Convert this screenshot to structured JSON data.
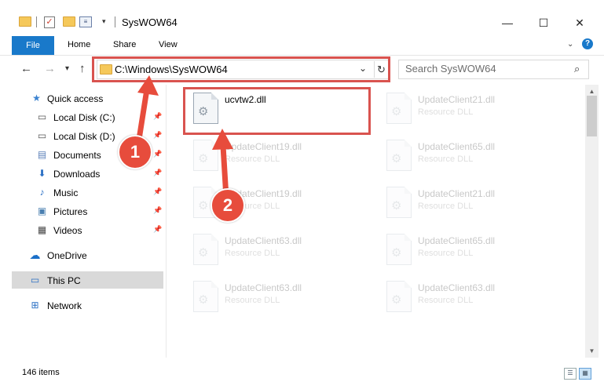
{
  "window": {
    "title": "SysWOW64"
  },
  "ribbon": {
    "tabs": [
      "File",
      "Home",
      "Share",
      "View"
    ]
  },
  "address": {
    "path": "C:\\Windows\\SysWOW64"
  },
  "search": {
    "placeholder": "Search SysWOW64"
  },
  "navigation": {
    "items": [
      {
        "label": "Quick access",
        "icon": "star-icon",
        "pinned": false
      },
      {
        "label": "Local Disk (C:)",
        "icon": "drive-icon",
        "pinned": true
      },
      {
        "label": "Local Disk (D:)",
        "icon": "drive-icon",
        "pinned": true
      },
      {
        "label": "Documents",
        "icon": "documents-icon",
        "pinned": true
      },
      {
        "label": "Downloads",
        "icon": "download-arrow-icon",
        "pinned": true
      },
      {
        "label": "Music",
        "icon": "music-note-icon",
        "pinned": true
      },
      {
        "label": "Pictures",
        "icon": "pictures-icon",
        "pinned": true
      },
      {
        "label": "Videos",
        "icon": "film-icon",
        "pinned": true
      },
      {
        "label": "OneDrive",
        "icon": "cloud-icon",
        "pinned": false
      },
      {
        "label": "This PC",
        "icon": "monitor-icon",
        "pinned": false,
        "selected": true
      },
      {
        "label": "Network",
        "icon": "network-icon",
        "pinned": false
      }
    ]
  },
  "files": [
    {
      "name": "ucvtw2.dll",
      "type": "",
      "highlighted": true
    },
    {
      "name": "UpdateClient21.dll",
      "type": "Resource DLL"
    },
    {
      "name": "UpdateClient19.dll",
      "type": "Resource DLL"
    },
    {
      "name": "UpdateClient65.dll",
      "type": "Resource DLL"
    },
    {
      "name": "UpdateClient19.dll",
      "type": "Resource DLL"
    },
    {
      "name": "UpdateClient21.dll",
      "type": "Resource DLL"
    },
    {
      "name": "UpdateClient63.dll",
      "type": "Resource DLL"
    },
    {
      "name": "UpdateClient65.dll",
      "type": "Resource DLL"
    },
    {
      "name": "UpdateClient63.dll",
      "type": "Resource DLL"
    },
    {
      "name": "UpdateClient63.dll",
      "type": "Resource DLL"
    }
  ],
  "status": {
    "item_count": "146 items"
  },
  "annotations": {
    "step1": "1",
    "step2": "2",
    "color": "#e74c3c"
  }
}
